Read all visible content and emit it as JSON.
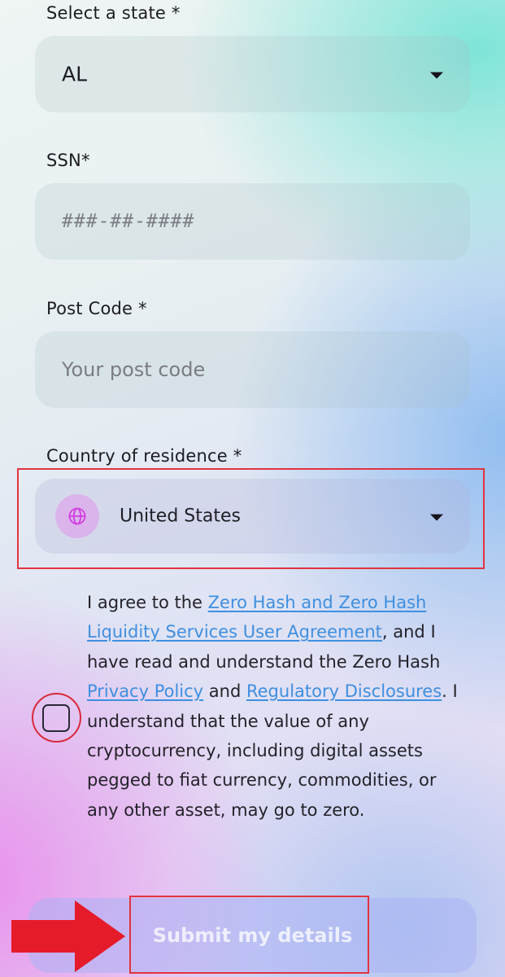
{
  "form": {
    "state": {
      "label": "Select a state *",
      "value": "AL"
    },
    "ssn": {
      "label": "SSN*",
      "placeholder": "###-##-####"
    },
    "post_code": {
      "label": "Post Code *",
      "placeholder": "Your post code"
    },
    "country": {
      "label": "Country of residence *",
      "value": "United States",
      "icon": "globe-icon"
    }
  },
  "agreement": {
    "checked": false,
    "text_1": "I agree to the ",
    "link_user_agreement": "Zero Hash and Zero Hash Liquidity Services User Agreement",
    "text_2": ", and I have read and understand the Zero Hash ",
    "link_privacy": "Privacy Policy",
    "text_3": " and ",
    "link_disclosures": "Regulatory Disclosures",
    "text_4": ". I understand that the value of any cryptocurrency, including digital assets pegged to fiat currency, commodities, or any other asset, may go to zero."
  },
  "submit": {
    "label": "Submit my details"
  },
  "colors": {
    "annotation_red": "#e2333f",
    "link_blue": "#3f8fe0",
    "globe_magenta": "#d23ee0"
  }
}
